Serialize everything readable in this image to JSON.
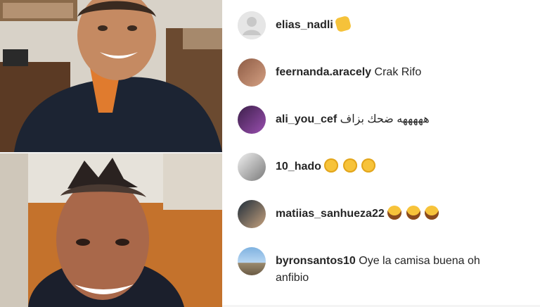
{
  "video": {
    "top_icon": "video-feed-person-1",
    "bottom_icon": "video-feed-person-2"
  },
  "comments": [
    {
      "username": "elias_nadli",
      "text": "",
      "emojis": [
        "clapping-hands-emoji"
      ]
    },
    {
      "username": "feernanda.aracely",
      "text": "Crak Rifo",
      "emojis": []
    },
    {
      "username": "ali_you_cef",
      "text": "هههههه ضحك بزاف",
      "emojis": []
    },
    {
      "username": "10_hado",
      "text": "",
      "emojis": [
        "heart-eyes-emoji",
        "heart-eyes-emoji",
        "heart-eyes-emoji"
      ]
    },
    {
      "username": "matiias_sanhueza22",
      "text": "",
      "emojis": [
        "laughing-emoji",
        "laughing-emoji",
        "laughing-emoji"
      ]
    },
    {
      "username": "byronsantos10",
      "text": "Oye la camisa buena oh anfibio",
      "emojis": []
    }
  ],
  "colors": {
    "text": "#262626",
    "background": "#ffffff"
  }
}
